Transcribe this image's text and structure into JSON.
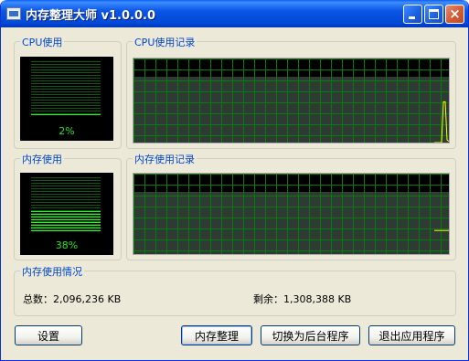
{
  "window": {
    "title": "内存整理大师 v1.0.0.0"
  },
  "titlebar_buttons": {
    "minimize": "minimize",
    "maximize": "maximize",
    "close": "×"
  },
  "cpu_usage": {
    "label": "CPU使用",
    "value": "2%",
    "percent": 2
  },
  "cpu_history": {
    "label": "CPU使用记录"
  },
  "mem_usage": {
    "label": "内存使用",
    "value": "38%",
    "percent": 38
  },
  "mem_history": {
    "label": "内存使用记录"
  },
  "mem_info": {
    "label": "内存使用情况",
    "total": "总数：2,096,236 KB",
    "free": "剩余：1,308,388 KB"
  },
  "buttons": {
    "settings": "设置",
    "clean": "内存整理",
    "background": "切换为后台程序",
    "exit": "退出应用程序"
  },
  "colors": {
    "titlebar": "#0054e3",
    "meter_fill": "#2ff02f",
    "grid": "#008000",
    "trace": "#ffff00",
    "group_label": "#0046d5"
  },
  "chart_data": [
    {
      "type": "line",
      "title": "CPU使用记录",
      "series": [
        {
          "values": [
            0,
            0,
            0,
            0,
            0,
            62,
            62,
            4,
            2
          ]
        }
      ],
      "ylim": [
        0,
        100
      ]
    },
    {
      "type": "line",
      "title": "内存使用记录",
      "series": [
        {
          "values": [
            38,
            38,
            38,
            38,
            38,
            38,
            38,
            38,
            38
          ]
        }
      ],
      "ylim": [
        0,
        100
      ]
    }
  ]
}
